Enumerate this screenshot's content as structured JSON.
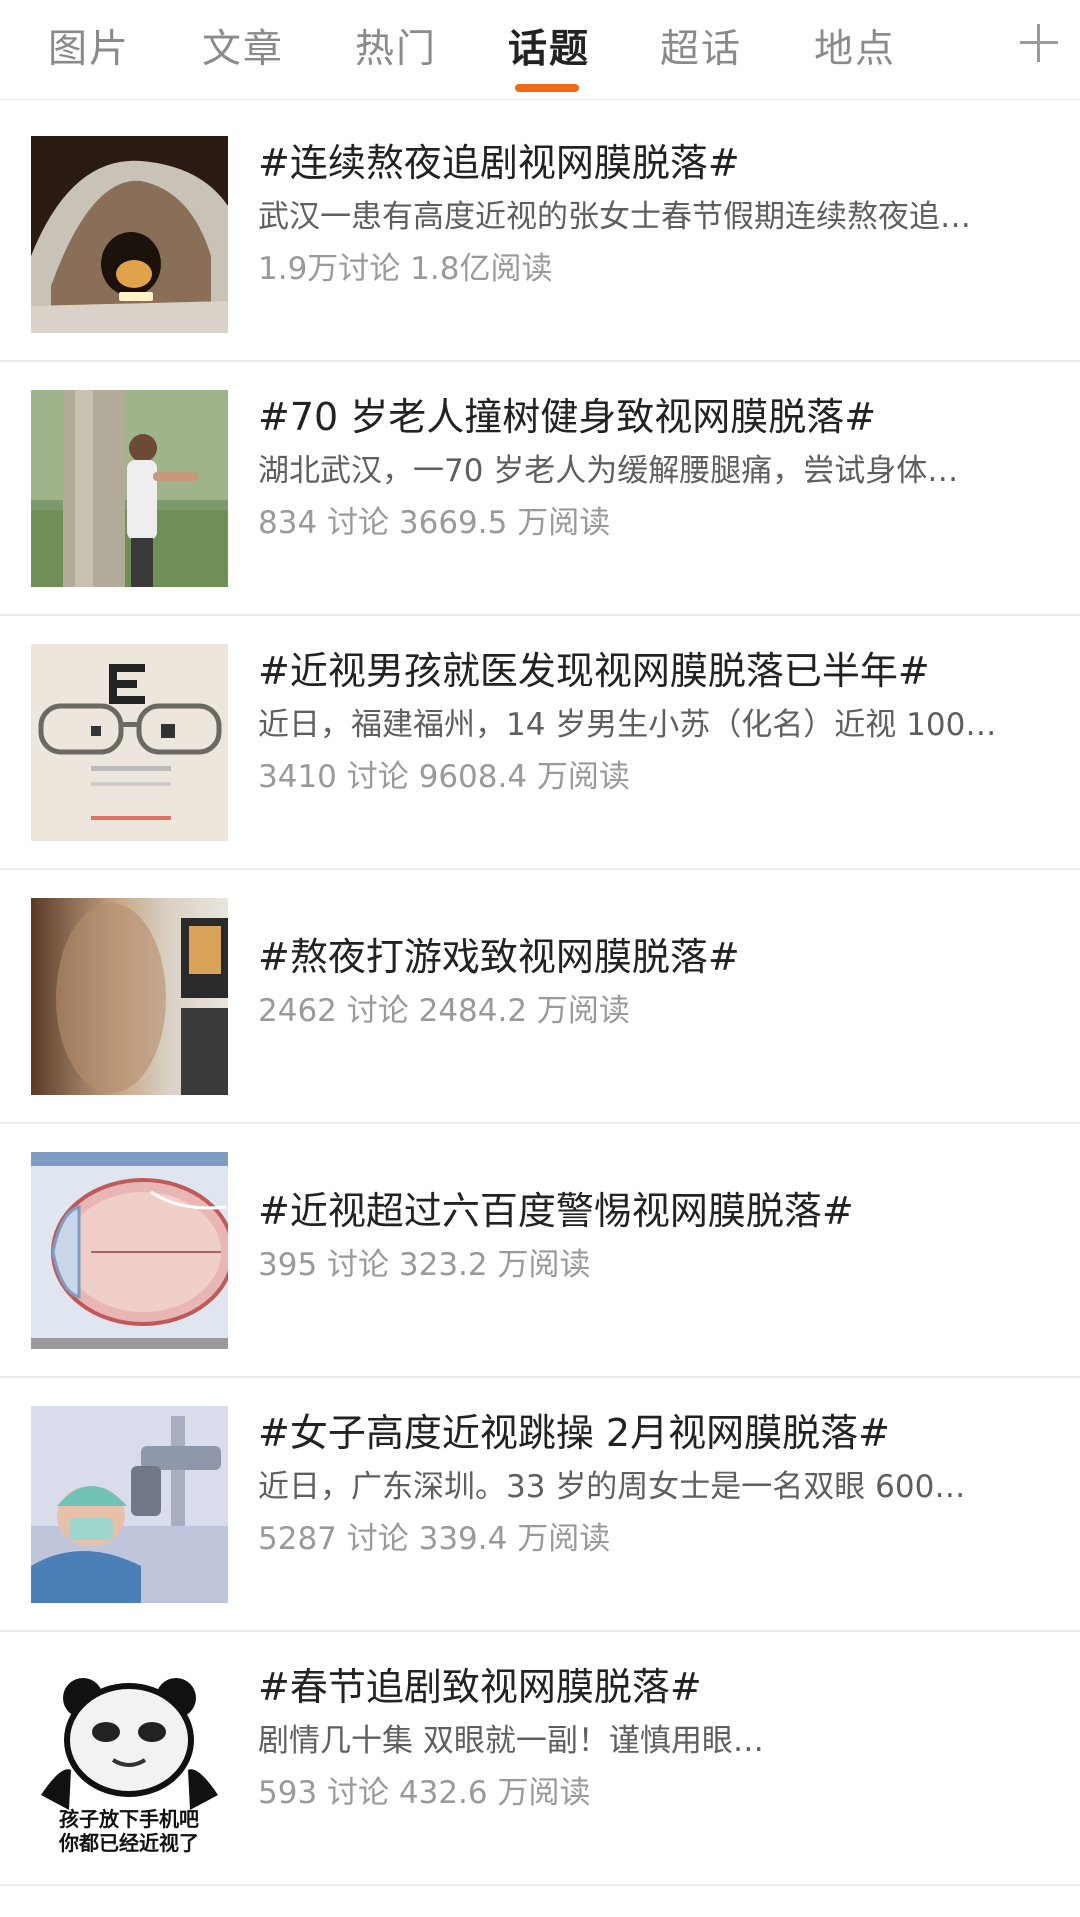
{
  "tabs": [
    {
      "label": "图片"
    },
    {
      "label": "文章"
    },
    {
      "label": "热门"
    },
    {
      "label": "话题"
    },
    {
      "label": "超话"
    },
    {
      "label": "地点"
    }
  ],
  "active_tab": "话题",
  "accent_color": "#f06a16",
  "add_icon": "plus-icon",
  "topics": [
    {
      "title": "#连续熬夜追剧视网膜脱落#",
      "desc": "武汉一患有高度近视的张女士春节假期连续熬夜追…",
      "stats": "1.9万讨论 1.8亿阅读",
      "thumb": "person-under-blanket-with-phone"
    },
    {
      "title": "#70 岁老人撞树健身致视网膜脱落#",
      "desc": "湖北武汉，一70 岁老人为缓解腰腿痛，尝试身体…",
      "stats": "834 讨论 3669.5 万阅读",
      "thumb": "man-next-to-tree"
    },
    {
      "title": "#近视男孩就医发现视网膜脱落已半年#",
      "desc": "近日，福建福州，14 岁男生小苏（化名）近视 100…",
      "stats": "3410 讨论 9608.4 万阅读",
      "thumb": "glasses-eye-chart"
    },
    {
      "title": "#熬夜打游戏致视网膜脱落#",
      "desc": "",
      "stats": "2462 讨论 2484.2 万阅读",
      "thumb": "blurred-gaming-scene"
    },
    {
      "title": "#近视超过六百度警惕视网膜脱落#",
      "desc": "",
      "stats": "395 讨论 323.2 万阅读",
      "thumb": "eyeball-diagram"
    },
    {
      "title": "#女子高度近视跳操 2月视网膜脱落#",
      "desc": "近日，广东深圳。33 岁的周女士是一名双眼 600…",
      "stats": "5287 讨论 339.4 万阅读",
      "thumb": "doctor-with-microscope"
    },
    {
      "title": "#春节追剧致视网膜脱落#",
      "desc": "剧情几十集 双眼就一副！谨慎用眼…",
      "stats": "593 讨论 432.6 万阅读",
      "thumb": "panda-meme",
      "thumb_text": [
        "孩子放下手机吧",
        "你都已经近视了"
      ]
    }
  ]
}
